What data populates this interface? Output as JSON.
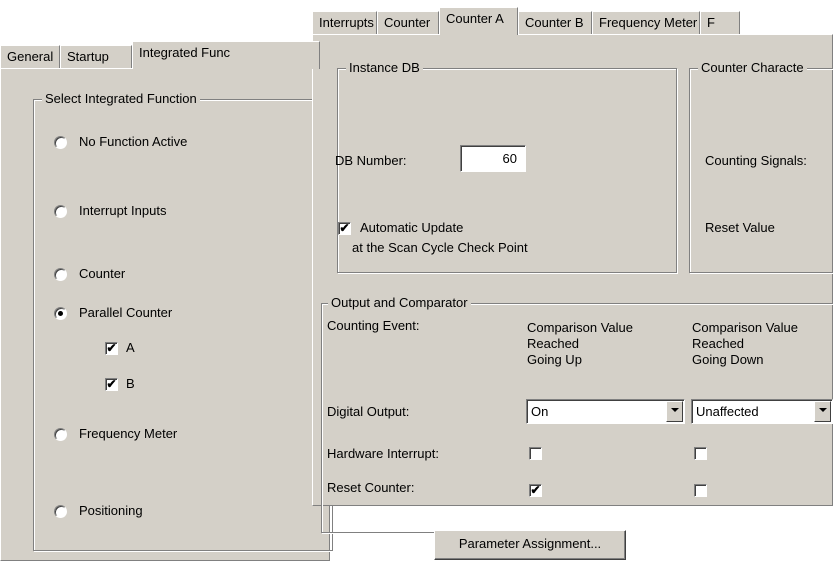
{
  "back_window": {
    "tabs": [
      "General",
      "Startup",
      "Integrated Func"
    ],
    "group_title": "Select Integrated Function",
    "options": [
      {
        "label": "No Function Active",
        "checked": false
      },
      {
        "label": "Interrupt Inputs",
        "checked": false
      },
      {
        "label": "Counter",
        "checked": false
      },
      {
        "label": "Parallel Counter",
        "checked": true
      },
      {
        "label": "Frequency Meter",
        "checked": false
      },
      {
        "label": "Positioning",
        "checked": false
      }
    ],
    "sub_checks": [
      {
        "label": "A",
        "checked": true
      },
      {
        "label": "B",
        "checked": true
      }
    ]
  },
  "front_window": {
    "tabs": [
      "Interrupts",
      "Counter",
      "Counter A",
      "Counter B",
      "Frequency Meter",
      "F"
    ],
    "active_tab": "Counter A",
    "instance_db": {
      "title": "Instance DB",
      "db_number_label": "DB Number:",
      "db_number_value": "60",
      "auto_update_label_1": "Automatic Update",
      "auto_update_label_2": "at the Scan Cycle Check Point",
      "auto_update_checked": true
    },
    "counter_characteristics": {
      "title": "Counter Characte",
      "counting_signals_label": "Counting Signals:",
      "reset_value_label": "Reset Value"
    },
    "output_comparator": {
      "title": "Output and Comparator",
      "counting_event_label": "Counting Event:",
      "col1_header": [
        "Comparison Value",
        "Reached",
        "Going Up"
      ],
      "col2_header": [
        "Comparison Value",
        "Reached",
        "Going Down"
      ],
      "digital_output_label": "Digital Output:",
      "digital_output_up": "On",
      "digital_output_down": "Unaffected",
      "hw_interrupt_label": "Hardware Interrupt:",
      "hw_interrupt_up": false,
      "hw_interrupt_down": false,
      "reset_counter_label": "Reset Counter:",
      "reset_counter_up": true,
      "reset_counter_down": false
    },
    "parameter_button": "Parameter Assignment..."
  }
}
